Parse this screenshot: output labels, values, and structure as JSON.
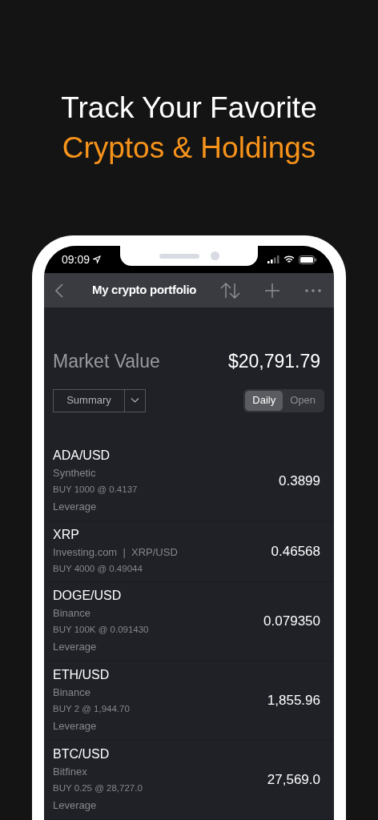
{
  "headline": [
    {
      "text": "Track Your Favorite",
      "accent": false
    },
    {
      "text": "Cryptos & Holdings",
      "accent": true
    }
  ],
  "status_bar": {
    "time": "09:09"
  },
  "nav": {
    "title": "My crypto portfolio"
  },
  "market_value": {
    "label": "Market Value",
    "value": "$20,791.79"
  },
  "view_dropdown": {
    "value": "Summary"
  },
  "period_tabs": [
    {
      "label": "Daily",
      "selected": true
    },
    {
      "label": "Open",
      "selected": false
    }
  ],
  "holdings": [
    {
      "symbol": "ADA/USD",
      "source": "Synthetic",
      "order": "BUY 1000 @ 0.4137",
      "tag": "Leverage",
      "price": "0.3899"
    },
    {
      "symbol": "XRP",
      "source": "Investing.com  |  XRP/USD",
      "order": "BUY 4000 @ 0.49044",
      "price": "0.46568"
    },
    {
      "symbol": "DOGE/USD",
      "source": "Binance",
      "order": "BUY 100K @ 0.091430",
      "tag": "Leverage",
      "price": "0.079350"
    },
    {
      "symbol": "ETH/USD",
      "source": "Binance",
      "order": "BUY 2 @ 1,944.70",
      "tag": "Leverage",
      "price": "1,855.96"
    },
    {
      "symbol": "BTC/USD",
      "source": "Bitfinex",
      "order": "BUY 0.25 @ 28,727.0",
      "tag": "Leverage",
      "price": "27,569.0"
    }
  ]
}
